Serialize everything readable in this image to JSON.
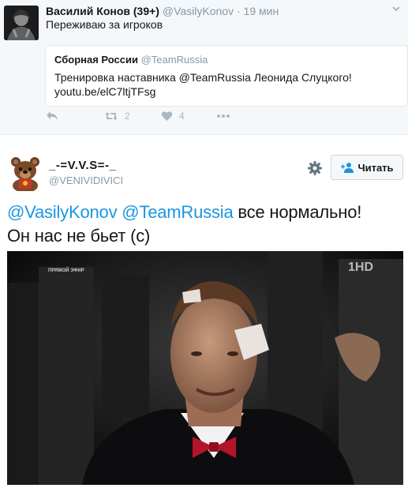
{
  "tweet1": {
    "display_name": "Василий Конов (39+)",
    "handle": "@VasilyKonov",
    "separator": "·",
    "time": "19 мин",
    "text": "Переживаю за игроков",
    "quote": {
      "display_name": "Сборная России",
      "handle": "@TeamRussia",
      "text_line1": "Тренировка наставника @TeamRussia Леонида Слуцкого!",
      "text_line2": "youtu.be/elC7ltjTFsg"
    },
    "actions": {
      "reply_icon": "reply-icon",
      "retweet_icon": "retweet-icon",
      "retweet_count": "2",
      "like_icon": "heart-icon",
      "like_count": "4",
      "more_icon": "more-dots-icon"
    }
  },
  "tweet2": {
    "display_name": "_-=V.V.S=-_",
    "handle": "@VENIVIDIVICI",
    "follow_label": "Читать",
    "mention1": "@VasilyKonov",
    "mention2": "@TeamRussia",
    "text_rest": " все нормально!",
    "text_line2": "Он нас не бьет (с)",
    "media": {
      "channel_badge": "1HD",
      "overlay_label": "ПРЯМОЙ ЭФИР"
    }
  },
  "colors": {
    "link": "#1b95e0",
    "muted": "#8899a6",
    "icon": "#aab8c2",
    "bg_top": "#f5f8fa"
  }
}
